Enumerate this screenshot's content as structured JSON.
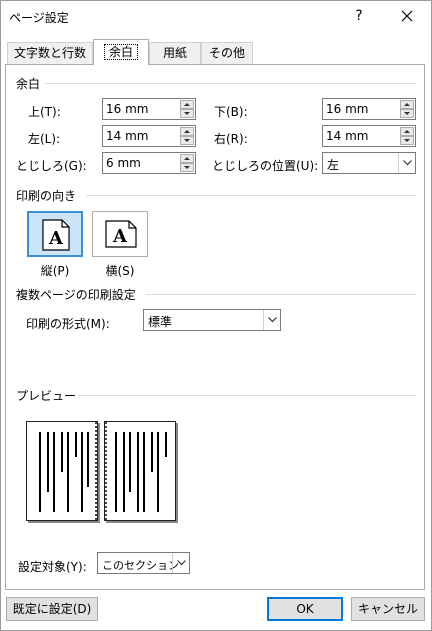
{
  "window": {
    "title": "ページ設定",
    "help": "?"
  },
  "tabs": [
    {
      "label": "文字数と行数"
    },
    {
      "label": "余白"
    },
    {
      "label": "用紙"
    },
    {
      "label": "その他"
    }
  ],
  "margins": {
    "section_label": "余白",
    "top_label": "上(T):",
    "top_value": "16 mm",
    "bottom_label": "下(B):",
    "bottom_value": "16 mm",
    "left_label": "左(L):",
    "left_value": "14 mm",
    "right_label": "右(R):",
    "right_value": "14 mm",
    "gutter_label": "とじしろ(G):",
    "gutter_value": "6 mm",
    "gutter_pos_label": "とじしろの位置(U):",
    "gutter_pos_value": "左"
  },
  "orientation": {
    "section_label": "印刷の向き",
    "portrait_label": "縦(P)",
    "landscape_label": "横(S)",
    "icon_letter": "A"
  },
  "multiple_pages": {
    "section_label": "複数ページの印刷設定",
    "format_label": "印刷の形式(M):",
    "format_value": "標準"
  },
  "preview": {
    "section_label": "プレビュー"
  },
  "apply_to": {
    "label": "設定対象(Y):",
    "value": "このセクション"
  },
  "buttons": {
    "default_label": "既定に設定(D)",
    "ok_label": "OK",
    "cancel_label": "キャンセル"
  },
  "colors": {
    "accent": "#0078d7",
    "selection_bg": "#cce4f7"
  }
}
